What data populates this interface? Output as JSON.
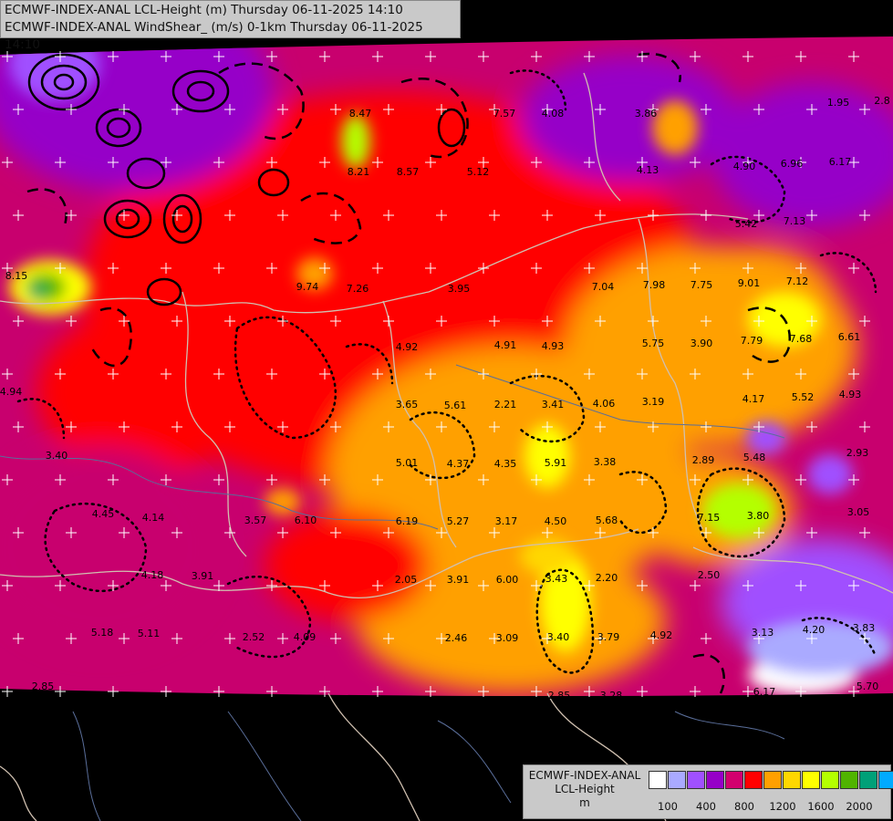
{
  "header": {
    "line1": "ECMWF-INDEX-ANAL LCL-Height (m) Thursday 06-11-2025 14:10",
    "line2": "ECMWF-INDEX-ANAL WindShear_ (m/s) 0-1km Thursday 06-11-2025 14:10"
  },
  "legend": {
    "title1": "ECMWF-INDEX-ANAL",
    "title2": "LCL-Height",
    "unit": "m",
    "colors": [
      "#ffffff",
      "#aaaaff",
      "#a050ff",
      "#9600c8",
      "#d2006e",
      "#ff0000",
      "#ffa000",
      "#ffd700",
      "#ffff00",
      "#b4ff00",
      "#50b400",
      "#00a078",
      "#00aaff"
    ],
    "ticks": [
      "100",
      "400",
      "800",
      "1200",
      "1600",
      "2000"
    ]
  },
  "station_values": [
    {
      "text": "8.47"
    },
    {
      "text": "8.21"
    },
    {
      "text": "8.57"
    },
    {
      "text": "5.12"
    },
    {
      "text": "4.08"
    },
    {
      "text": "3.86"
    },
    {
      "text": "1.95"
    },
    {
      "text": "2.8"
    },
    {
      "text": "7.57"
    },
    {
      "text": "4.13"
    },
    {
      "text": "4.90"
    },
    {
      "text": "6.96"
    },
    {
      "text": "6.17"
    },
    {
      "text": "7.13"
    },
    {
      "text": "5.42"
    },
    {
      "text": "9.74"
    },
    {
      "text": "7.26"
    },
    {
      "text": "3.95"
    },
    {
      "text": "7.04"
    },
    {
      "text": "7.98"
    },
    {
      "text": "7.75"
    },
    {
      "text": "9.01"
    },
    {
      "text": "7.12"
    },
    {
      "text": "4.92"
    },
    {
      "text": "4.91"
    },
    {
      "text": "4.93"
    },
    {
      "text": "5.75"
    },
    {
      "text": "3.90"
    },
    {
      "text": "7.79"
    },
    {
      "text": "7.68"
    },
    {
      "text": "6.61"
    },
    {
      "text": "3.65"
    },
    {
      "text": "5.61"
    },
    {
      "text": "2.21"
    },
    {
      "text": "3.41"
    },
    {
      "text": "4.06"
    },
    {
      "text": "3.19"
    },
    {
      "text": "4.17"
    },
    {
      "text": "5.52"
    },
    {
      "text": "4.93"
    },
    {
      "text": "5.01"
    },
    {
      "text": "4.37"
    },
    {
      "text": "4.35"
    },
    {
      "text": "5.91"
    },
    {
      "text": "3.38"
    },
    {
      "text": "2.89"
    },
    {
      "text": "5.48"
    },
    {
      "text": "2.93"
    },
    {
      "text": "3.57"
    },
    {
      "text": "6.10"
    },
    {
      "text": "6.19"
    },
    {
      "text": "5.27"
    },
    {
      "text": "3.17"
    },
    {
      "text": "4.50"
    },
    {
      "text": "5.68"
    },
    {
      "text": "7.15"
    },
    {
      "text": "3.80"
    },
    {
      "text": "3.05"
    },
    {
      "text": "2.05"
    },
    {
      "text": "3.91"
    },
    {
      "text": "6.00"
    },
    {
      "text": "3.43"
    },
    {
      "text": "2.20"
    },
    {
      "text": "2.50"
    },
    {
      "text": "2.52"
    },
    {
      "text": "4.09"
    },
    {
      "text": "2.46"
    },
    {
      "text": "3.09"
    },
    {
      "text": "3.40"
    },
    {
      "text": "3.79"
    },
    {
      "text": "4.92"
    },
    {
      "text": "3.13"
    },
    {
      "text": "4.20"
    },
    {
      "text": "3.83"
    },
    {
      "text": "2.85"
    },
    {
      "text": "3.28"
    },
    {
      "text": "6.17"
    },
    {
      "text": "5.70"
    },
    {
      "text": "4.45"
    },
    {
      "text": "4.14"
    },
    {
      "text": "4.18"
    },
    {
      "text": "3.91"
    },
    {
      "text": "5.18"
    },
    {
      "text": "5.11"
    },
    {
      "text": "4.94"
    },
    {
      "text": "3.40"
    },
    {
      "text": "8.15"
    },
    {
      "text": "2.85"
    }
  ]
}
